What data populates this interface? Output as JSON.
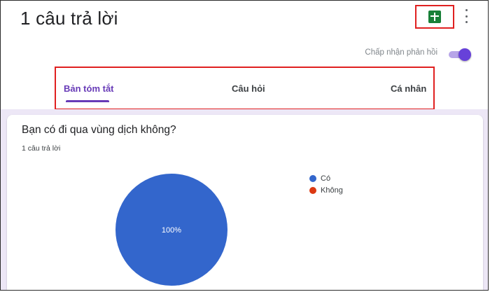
{
  "header": {
    "title": "1 câu trả lời",
    "sheets_icon": "google-sheets-icon",
    "more_icon": "more-vert-icon"
  },
  "accept": {
    "label": "Chấp nhận phản hồi",
    "enabled": true
  },
  "tabs": [
    {
      "label": "Bản tóm tắt",
      "active": true
    },
    {
      "label": "Câu hỏi",
      "active": false
    },
    {
      "label": "Cá nhân",
      "active": false
    }
  ],
  "colors": {
    "accent": "#673ab7",
    "highlight_border": "#e02020",
    "slice_co": "#3366cc",
    "slice_khong": "#dc3912"
  },
  "summary": {
    "question": "Bạn có đi qua vùng dịch không?",
    "response_count": "1 câu trả lời"
  },
  "chart_data": {
    "type": "pie",
    "categories": [
      "Có",
      "Không"
    ],
    "values": [
      100,
      0
    ],
    "slice_label": "100%",
    "legend_position": "right"
  }
}
